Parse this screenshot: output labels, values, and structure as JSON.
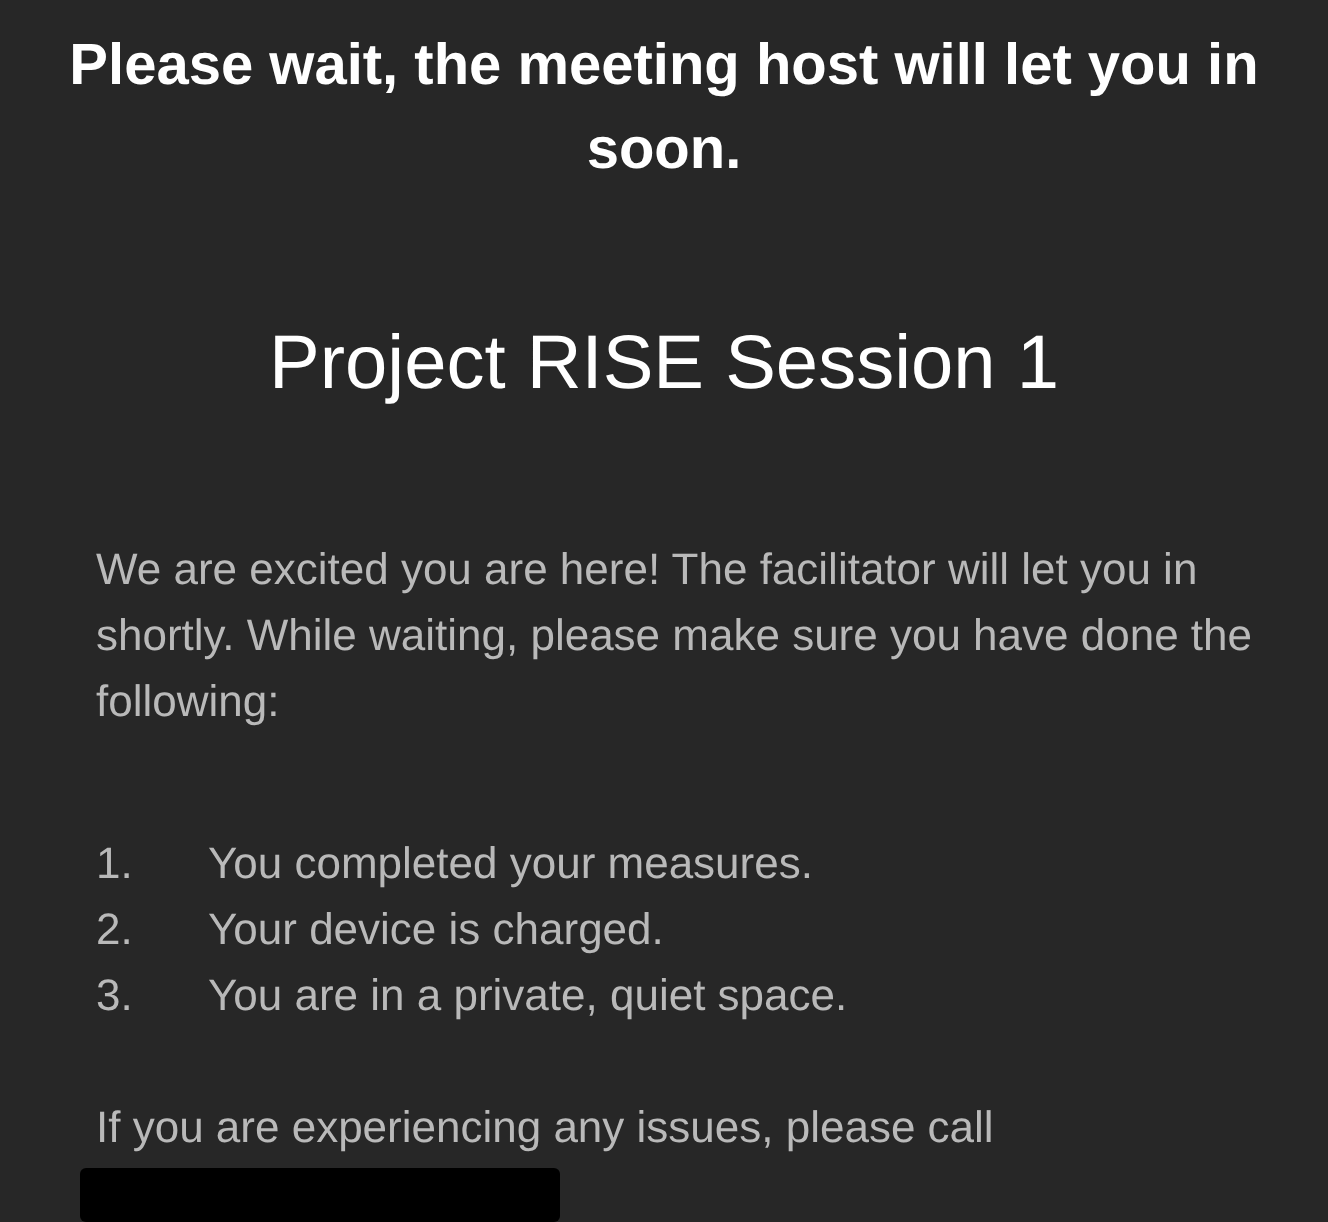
{
  "header": {
    "message": "Please wait, the meeting host will let you in soon."
  },
  "meeting": {
    "title": "Project RISE Session 1",
    "intro": "We are excited you are here! The facilitator will let you in shortly. While waiting, please make sure you have done the following:",
    "checklist": [
      {
        "number": "1.",
        "text": "You completed your measures."
      },
      {
        "number": "2.",
        "text": "Your device is charged."
      },
      {
        "number": "3.",
        "text": "You are in a private, quiet space."
      }
    ],
    "help": "If you are experiencing any issues, please call"
  }
}
